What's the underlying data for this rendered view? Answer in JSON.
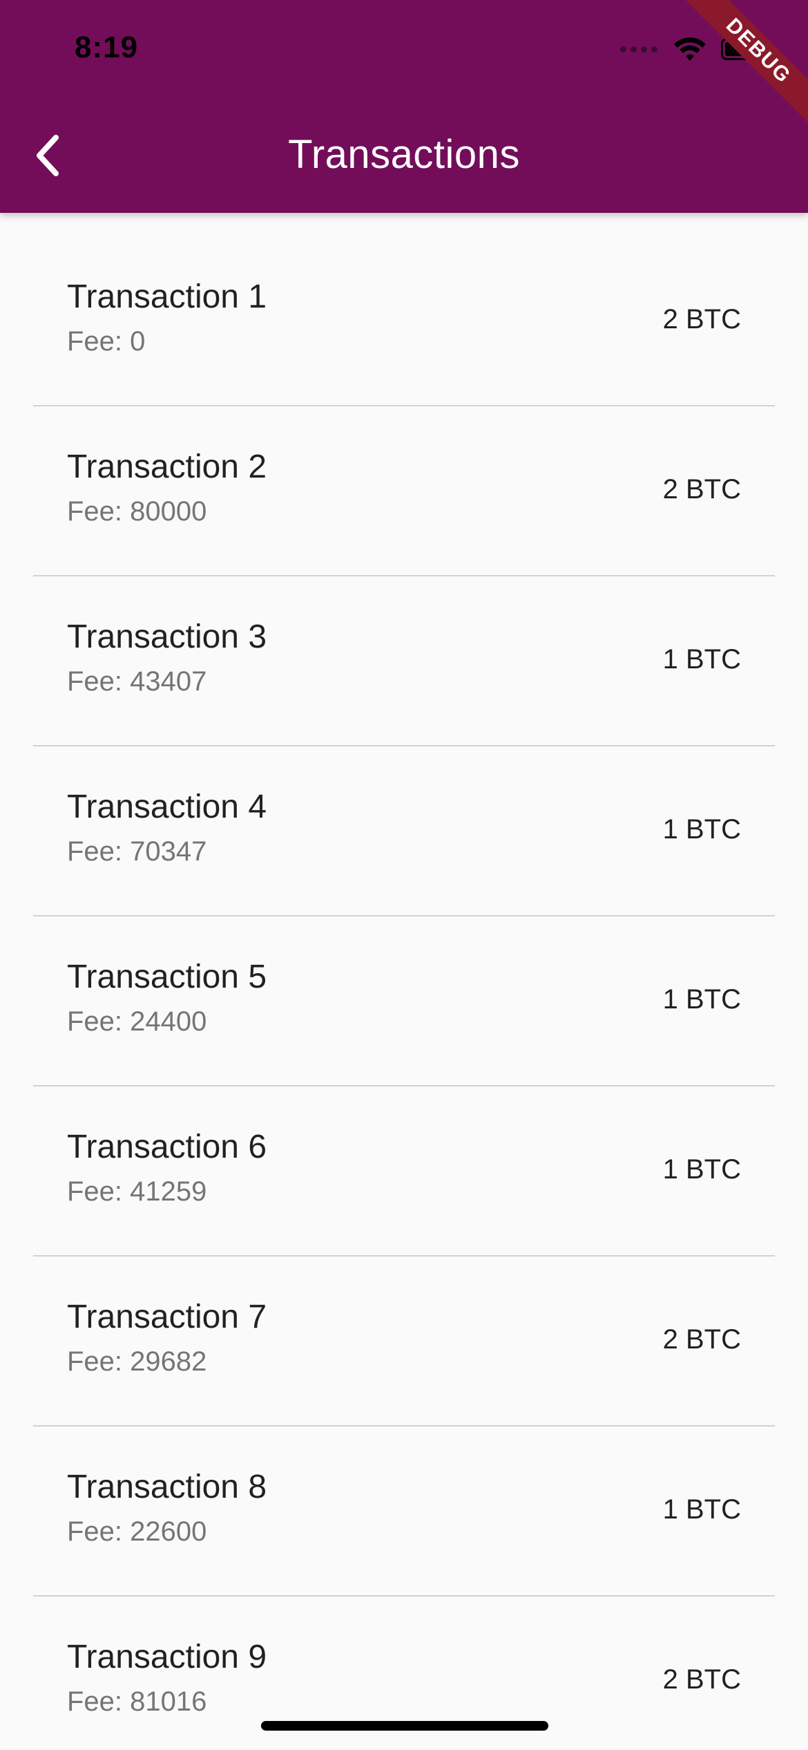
{
  "status_bar": {
    "time": "8:19"
  },
  "appbar": {
    "title": "Transactions",
    "back_icon": "chevron-left-icon",
    "background_color": "#730d5a"
  },
  "debug_banner": {
    "label": "DEBUG"
  },
  "transactions": [
    {
      "title": "Transaction 1",
      "fee": "Fee: 0",
      "amount": "2 BTC"
    },
    {
      "title": "Transaction 2",
      "fee": "Fee: 80000",
      "amount": "2 BTC"
    },
    {
      "title": "Transaction 3",
      "fee": "Fee: 43407",
      "amount": "1 BTC"
    },
    {
      "title": "Transaction 4",
      "fee": "Fee: 70347",
      "amount": "1 BTC"
    },
    {
      "title": "Transaction 5",
      "fee": "Fee: 24400",
      "amount": "1 BTC"
    },
    {
      "title": "Transaction 6",
      "fee": "Fee: 41259",
      "amount": "1 BTC"
    },
    {
      "title": "Transaction 7",
      "fee": "Fee: 29682",
      "amount": "2 BTC"
    },
    {
      "title": "Transaction 8",
      "fee": "Fee: 22600",
      "amount": "1 BTC"
    },
    {
      "title": "Transaction 9",
      "fee": "Fee: 81016",
      "amount": "2 BTC"
    }
  ]
}
